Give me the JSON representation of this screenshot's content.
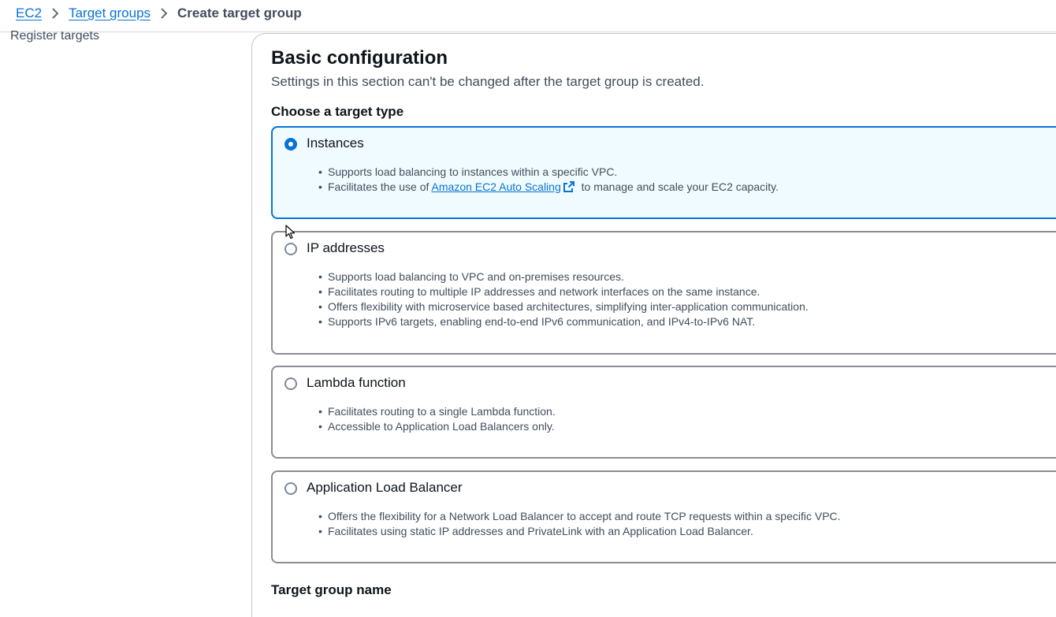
{
  "breadcrumb": {
    "items": [
      "EC2",
      "Target groups"
    ],
    "current": "Create target group"
  },
  "side_nav": {
    "current_step": "Register targets"
  },
  "section": {
    "title": "Basic configuration",
    "description": "Settings in this section can't be changed after the target group is created."
  },
  "target_type": {
    "label": "Choose a target type",
    "selected": "Instances",
    "options": [
      {
        "label": "Instances",
        "bullets": [
          "Supports load balancing to instances within a specific VPC."
        ],
        "link_bullet": {
          "before": "Facilitates the use of ",
          "link": "Amazon EC2 Auto Scaling",
          "after": " to manage and scale your EC2 capacity."
        }
      },
      {
        "label": "IP addresses",
        "bullets": [
          "Supports load balancing to VPC and on-premises resources.",
          "Facilitates routing to multiple IP addresses and network interfaces on the same instance.",
          "Offers flexibility with microservice based architectures, simplifying inter-application communication.",
          "Supports IPv6 targets, enabling end-to-end IPv6 communication, and IPv4-to-IPv6 NAT."
        ]
      },
      {
        "label": "Lambda function",
        "bullets": [
          "Facilitates routing to a single Lambda function.",
          "Accessible to Application Load Balancers only."
        ]
      },
      {
        "label": "Application Load Balancer",
        "bullets": [
          "Offers the flexibility for a Network Load Balancer to accept and route TCP requests within a specific VPC.",
          "Facilitates using static IP addresses and PrivateLink with an Application Load Balancer."
        ]
      }
    ]
  },
  "next_field": {
    "label": "Target group name"
  },
  "colors": {
    "link": "#0972d3",
    "selected_border": "#0972d3",
    "selected_background": "#f0fbff"
  },
  "icons": [
    "chevron-right-icon",
    "external-link-icon",
    "mouse-pointer-icon"
  ]
}
